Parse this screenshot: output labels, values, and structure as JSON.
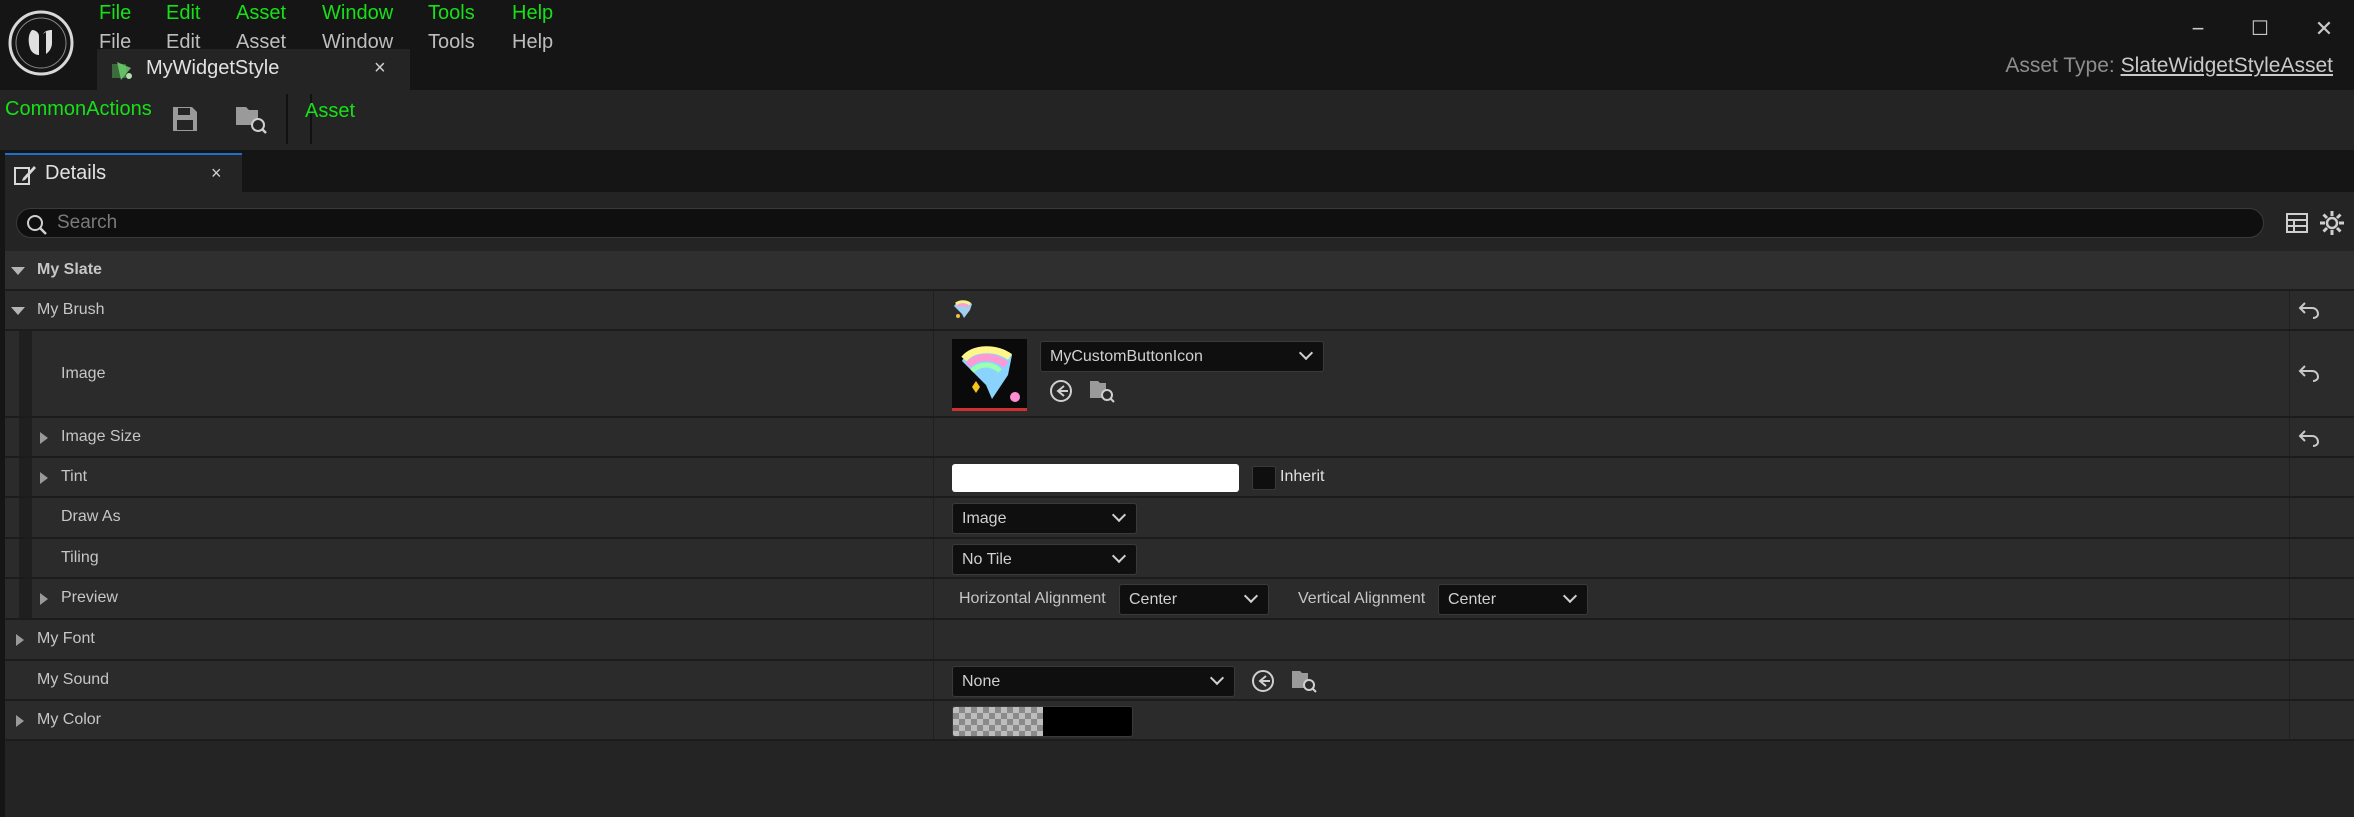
{
  "menu": {
    "items_green": [
      "File",
      "Edit",
      "Asset",
      "Window",
      "Tools",
      "Help"
    ],
    "items_grey": [
      "File",
      "Edit",
      "Asset",
      "Window",
      "Tools",
      "Help"
    ]
  },
  "document_tab": {
    "title": "MyWidgetStyle",
    "close": "×"
  },
  "window_controls": {
    "minimize": "−",
    "maximize": "☐",
    "close": "✕"
  },
  "asset_type": {
    "label": "Asset Type:",
    "value": "SlateWidgetStyleAsset"
  },
  "toolbar": {
    "common_actions": "CommonActions",
    "asset": "Asset"
  },
  "details_tab": {
    "title": "Details",
    "close": "×"
  },
  "search": {
    "placeholder": "Search"
  },
  "properties": {
    "my_slate": "My Slate",
    "my_brush": "My Brush",
    "image": "Image",
    "image_asset": "MyCustomButtonIcon",
    "image_size": "Image Size",
    "tint": "Tint",
    "inherit": "Inherit",
    "draw_as": "Draw As",
    "draw_as_value": "Image",
    "tiling": "Tiling",
    "tiling_value": "No Tile",
    "preview": "Preview",
    "horizontal_alignment": "Horizontal Alignment",
    "horizontal_alignment_value": "Center",
    "vertical_alignment": "Vertical Alignment",
    "vertical_alignment_value": "Center",
    "my_font": "My Font",
    "my_sound": "My Sound",
    "my_sound_value": "None",
    "my_color": "My Color"
  },
  "colors": {
    "accent_green": "#16e016",
    "tab_highlight": "#1e6fd0",
    "tint_value": "#ffffff",
    "my_color_value": "#000000"
  },
  "icons": {
    "reset": "reset-arrow-icon",
    "save": "save-icon",
    "browse": "browse-to-asset-icon",
    "use_selected": "use-selected-icon",
    "settings": "gear-icon",
    "table": "table-view-icon",
    "search": "search-icon"
  }
}
